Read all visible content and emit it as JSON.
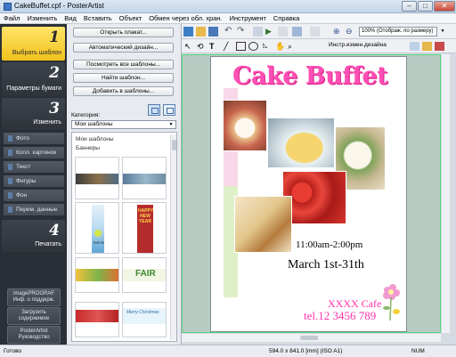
{
  "window": {
    "title": "CakeBuffet.cpf - PosterArtist",
    "minimize": "–",
    "maximize": "□",
    "close": "✕"
  },
  "menu": [
    "Файл",
    "Изменить",
    "Вид",
    "Вставить",
    "Объект",
    "Обмен через обл. хран.",
    "Инструмент",
    "Справка"
  ],
  "steps": [
    {
      "num": "1",
      "label": "Выбрать шаблон"
    },
    {
      "num": "2",
      "label": "Параметры бумаги"
    },
    {
      "num": "3",
      "label": "Изменить"
    },
    {
      "num": "4",
      "label": "Печатать"
    }
  ],
  "edit_subitems": [
    "Фото",
    "Колл. картинок",
    "Текст",
    "Фигуры",
    "Фон",
    "Перем. данные"
  ],
  "bottom_buttons": [
    {
      "line1": "imagePROGRAF",
      "line2": "Инф. о поддерж."
    },
    {
      "line1": "Загрузить",
      "line2": "содержимое"
    },
    {
      "line1": "PosterArtist",
      "line2": "Руководство"
    }
  ],
  "template_buttons": [
    "Открыть плакат...",
    "Автоматический дизайн...",
    "Посмотреть все шаблоны...",
    "Найти шаблон...",
    "Добавить в шаблоны..."
  ],
  "category": {
    "label": "Категория:",
    "value": "Мои шаблоны"
  },
  "template_list": {
    "header": "Мои шаблоны",
    "group": "Баннеры"
  },
  "toolbar": {
    "zoom": "100% (Отображ. по размеру)",
    "design_change": "Инстр.измен.дизайна"
  },
  "poster": {
    "title": "Cake Buffet",
    "time": "11:00am-2:00pm",
    "date": "March 1st-31th",
    "cafe": "XXXX Cafe",
    "tel": "tel.12 3456 789"
  },
  "thumb_texts": {
    "happy_new_year": "HAPPY NEW YEAR",
    "tennis": "tennis",
    "fair": "FAIR",
    "merry_christmas": "Merry Christmas"
  },
  "status": {
    "left": "Готово",
    "center": "594.0 x 841.0 [mm] (ISO A1)",
    "right": "NUM"
  },
  "colors": {
    "accent_step": "#f5c928",
    "poster_title": "#ff4fb4",
    "canvas_bg": "#b7cbc2"
  }
}
